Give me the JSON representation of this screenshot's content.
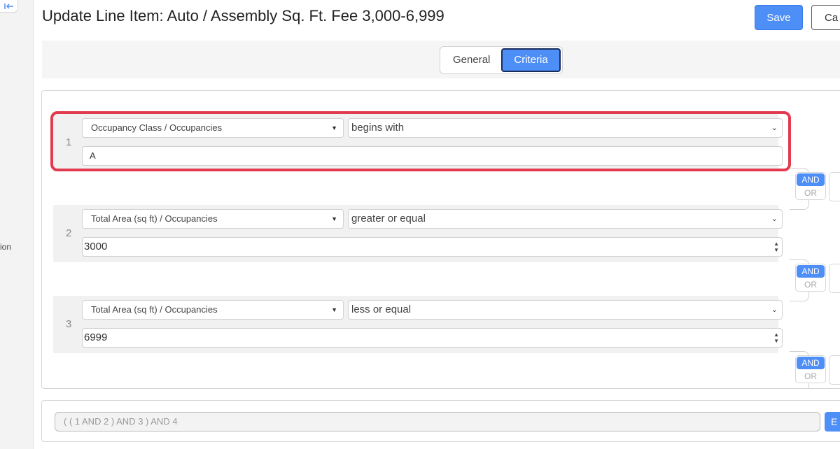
{
  "sidebar": {
    "partial_label": "ion"
  },
  "header": {
    "title": "Update Line Item: Auto / Assembly Sq. Ft. Fee 3,000-6,999",
    "save_label": "Save",
    "cancel_label": "Ca"
  },
  "tabs": [
    {
      "label": "General",
      "active": false
    },
    {
      "label": "Criteria",
      "active": true
    }
  ],
  "criteria": [
    {
      "num": "1",
      "field": "Occupancy Class / Occupancies",
      "operator": "begins with",
      "value": "A"
    },
    {
      "num": "2",
      "field": "Total Area (sq ft) / Occupancies",
      "operator": "greater or equal",
      "value": "3000"
    },
    {
      "num": "3",
      "field": "Total Area (sq ft) / Occupancies",
      "operator": "less or equal",
      "value": "6999"
    }
  ],
  "logic_toggles": [
    {
      "and": "AND",
      "or": "OR",
      "selected": "AND"
    },
    {
      "and": "AND",
      "or": "OR",
      "selected": "AND"
    },
    {
      "and": "AND",
      "or": "OR",
      "selected": "AND"
    }
  ],
  "expression": {
    "value": "( ( 1 AND 2 ) AND 3 ) AND 4",
    "button_label": "E"
  },
  "colors": {
    "accent": "#4d8ef7",
    "highlight": "#e23a4e"
  }
}
